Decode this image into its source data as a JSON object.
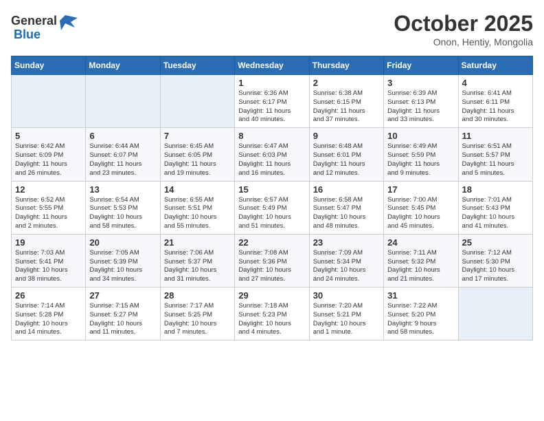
{
  "header": {
    "logo_general": "General",
    "logo_blue": "Blue",
    "month": "October 2025",
    "location": "Onon, Hentiy, Mongolia"
  },
  "days_of_week": [
    "Sunday",
    "Monday",
    "Tuesday",
    "Wednesday",
    "Thursday",
    "Friday",
    "Saturday"
  ],
  "weeks": [
    [
      {
        "day": "",
        "info": ""
      },
      {
        "day": "",
        "info": ""
      },
      {
        "day": "",
        "info": ""
      },
      {
        "day": "1",
        "info": "Sunrise: 6:36 AM\nSunset: 6:17 PM\nDaylight: 11 hours\nand 40 minutes."
      },
      {
        "day": "2",
        "info": "Sunrise: 6:38 AM\nSunset: 6:15 PM\nDaylight: 11 hours\nand 37 minutes."
      },
      {
        "day": "3",
        "info": "Sunrise: 6:39 AM\nSunset: 6:13 PM\nDaylight: 11 hours\nand 33 minutes."
      },
      {
        "day": "4",
        "info": "Sunrise: 6:41 AM\nSunset: 6:11 PM\nDaylight: 11 hours\nand 30 minutes."
      }
    ],
    [
      {
        "day": "5",
        "info": "Sunrise: 6:42 AM\nSunset: 6:09 PM\nDaylight: 11 hours\nand 26 minutes."
      },
      {
        "day": "6",
        "info": "Sunrise: 6:44 AM\nSunset: 6:07 PM\nDaylight: 11 hours\nand 23 minutes."
      },
      {
        "day": "7",
        "info": "Sunrise: 6:45 AM\nSunset: 6:05 PM\nDaylight: 11 hours\nand 19 minutes."
      },
      {
        "day": "8",
        "info": "Sunrise: 6:47 AM\nSunset: 6:03 PM\nDaylight: 11 hours\nand 16 minutes."
      },
      {
        "day": "9",
        "info": "Sunrise: 6:48 AM\nSunset: 6:01 PM\nDaylight: 11 hours\nand 12 minutes."
      },
      {
        "day": "10",
        "info": "Sunrise: 6:49 AM\nSunset: 5:59 PM\nDaylight: 11 hours\nand 9 minutes."
      },
      {
        "day": "11",
        "info": "Sunrise: 6:51 AM\nSunset: 5:57 PM\nDaylight: 11 hours\nand 5 minutes."
      }
    ],
    [
      {
        "day": "12",
        "info": "Sunrise: 6:52 AM\nSunset: 5:55 PM\nDaylight: 11 hours\nand 2 minutes."
      },
      {
        "day": "13",
        "info": "Sunrise: 6:54 AM\nSunset: 5:53 PM\nDaylight: 10 hours\nand 58 minutes."
      },
      {
        "day": "14",
        "info": "Sunrise: 6:55 AM\nSunset: 5:51 PM\nDaylight: 10 hours\nand 55 minutes."
      },
      {
        "day": "15",
        "info": "Sunrise: 6:57 AM\nSunset: 5:49 PM\nDaylight: 10 hours\nand 51 minutes."
      },
      {
        "day": "16",
        "info": "Sunrise: 6:58 AM\nSunset: 5:47 PM\nDaylight: 10 hours\nand 48 minutes."
      },
      {
        "day": "17",
        "info": "Sunrise: 7:00 AM\nSunset: 5:45 PM\nDaylight: 10 hours\nand 45 minutes."
      },
      {
        "day": "18",
        "info": "Sunrise: 7:01 AM\nSunset: 5:43 PM\nDaylight: 10 hours\nand 41 minutes."
      }
    ],
    [
      {
        "day": "19",
        "info": "Sunrise: 7:03 AM\nSunset: 5:41 PM\nDaylight: 10 hours\nand 38 minutes."
      },
      {
        "day": "20",
        "info": "Sunrise: 7:05 AM\nSunset: 5:39 PM\nDaylight: 10 hours\nand 34 minutes."
      },
      {
        "day": "21",
        "info": "Sunrise: 7:06 AM\nSunset: 5:37 PM\nDaylight: 10 hours\nand 31 minutes."
      },
      {
        "day": "22",
        "info": "Sunrise: 7:08 AM\nSunset: 5:36 PM\nDaylight: 10 hours\nand 27 minutes."
      },
      {
        "day": "23",
        "info": "Sunrise: 7:09 AM\nSunset: 5:34 PM\nDaylight: 10 hours\nand 24 minutes."
      },
      {
        "day": "24",
        "info": "Sunrise: 7:11 AM\nSunset: 5:32 PM\nDaylight: 10 hours\nand 21 minutes."
      },
      {
        "day": "25",
        "info": "Sunrise: 7:12 AM\nSunset: 5:30 PM\nDaylight: 10 hours\nand 17 minutes."
      }
    ],
    [
      {
        "day": "26",
        "info": "Sunrise: 7:14 AM\nSunset: 5:28 PM\nDaylight: 10 hours\nand 14 minutes."
      },
      {
        "day": "27",
        "info": "Sunrise: 7:15 AM\nSunset: 5:27 PM\nDaylight: 10 hours\nand 11 minutes."
      },
      {
        "day": "28",
        "info": "Sunrise: 7:17 AM\nSunset: 5:25 PM\nDaylight: 10 hours\nand 7 minutes."
      },
      {
        "day": "29",
        "info": "Sunrise: 7:18 AM\nSunset: 5:23 PM\nDaylight: 10 hours\nand 4 minutes."
      },
      {
        "day": "30",
        "info": "Sunrise: 7:20 AM\nSunset: 5:21 PM\nDaylight: 10 hours\nand 1 minute."
      },
      {
        "day": "31",
        "info": "Sunrise: 7:22 AM\nSunset: 5:20 PM\nDaylight: 9 hours\nand 58 minutes."
      },
      {
        "day": "",
        "info": ""
      }
    ]
  ]
}
